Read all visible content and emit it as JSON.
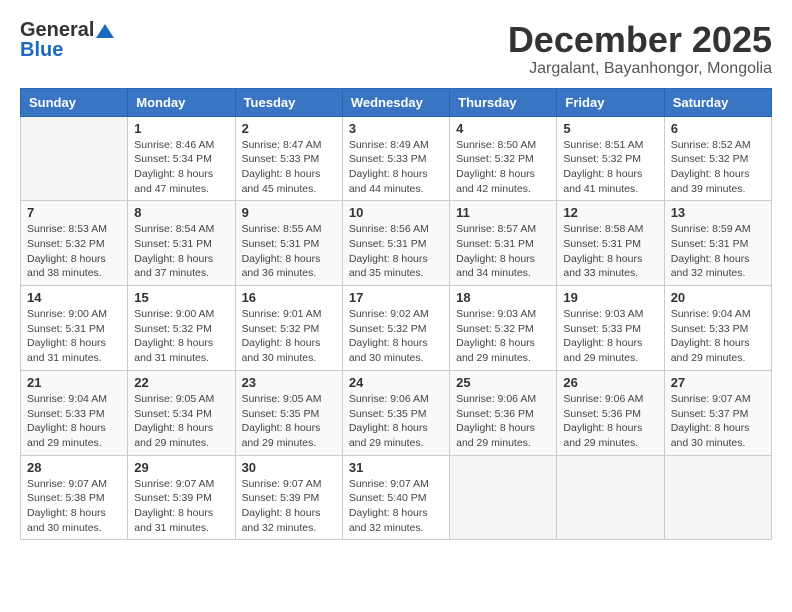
{
  "header": {
    "logo_general": "General",
    "logo_blue": "Blue",
    "month_title": "December 2025",
    "location": "Jargalant, Bayanhongor, Mongolia"
  },
  "days_of_week": [
    "Sunday",
    "Monday",
    "Tuesday",
    "Wednesday",
    "Thursday",
    "Friday",
    "Saturday"
  ],
  "weeks": [
    [
      {
        "day": "",
        "info": ""
      },
      {
        "day": "1",
        "info": "Sunrise: 8:46 AM\nSunset: 5:34 PM\nDaylight: 8 hours\nand 47 minutes."
      },
      {
        "day": "2",
        "info": "Sunrise: 8:47 AM\nSunset: 5:33 PM\nDaylight: 8 hours\nand 45 minutes."
      },
      {
        "day": "3",
        "info": "Sunrise: 8:49 AM\nSunset: 5:33 PM\nDaylight: 8 hours\nand 44 minutes."
      },
      {
        "day": "4",
        "info": "Sunrise: 8:50 AM\nSunset: 5:32 PM\nDaylight: 8 hours\nand 42 minutes."
      },
      {
        "day": "5",
        "info": "Sunrise: 8:51 AM\nSunset: 5:32 PM\nDaylight: 8 hours\nand 41 minutes."
      },
      {
        "day": "6",
        "info": "Sunrise: 8:52 AM\nSunset: 5:32 PM\nDaylight: 8 hours\nand 39 minutes."
      }
    ],
    [
      {
        "day": "7",
        "info": "Sunrise: 8:53 AM\nSunset: 5:32 PM\nDaylight: 8 hours\nand 38 minutes."
      },
      {
        "day": "8",
        "info": "Sunrise: 8:54 AM\nSunset: 5:31 PM\nDaylight: 8 hours\nand 37 minutes."
      },
      {
        "day": "9",
        "info": "Sunrise: 8:55 AM\nSunset: 5:31 PM\nDaylight: 8 hours\nand 36 minutes."
      },
      {
        "day": "10",
        "info": "Sunrise: 8:56 AM\nSunset: 5:31 PM\nDaylight: 8 hours\nand 35 minutes."
      },
      {
        "day": "11",
        "info": "Sunrise: 8:57 AM\nSunset: 5:31 PM\nDaylight: 8 hours\nand 34 minutes."
      },
      {
        "day": "12",
        "info": "Sunrise: 8:58 AM\nSunset: 5:31 PM\nDaylight: 8 hours\nand 33 minutes."
      },
      {
        "day": "13",
        "info": "Sunrise: 8:59 AM\nSunset: 5:31 PM\nDaylight: 8 hours\nand 32 minutes."
      }
    ],
    [
      {
        "day": "14",
        "info": "Sunrise: 9:00 AM\nSunset: 5:31 PM\nDaylight: 8 hours\nand 31 minutes."
      },
      {
        "day": "15",
        "info": "Sunrise: 9:00 AM\nSunset: 5:32 PM\nDaylight: 8 hours\nand 31 minutes."
      },
      {
        "day": "16",
        "info": "Sunrise: 9:01 AM\nSunset: 5:32 PM\nDaylight: 8 hours\nand 30 minutes."
      },
      {
        "day": "17",
        "info": "Sunrise: 9:02 AM\nSunset: 5:32 PM\nDaylight: 8 hours\nand 30 minutes."
      },
      {
        "day": "18",
        "info": "Sunrise: 9:03 AM\nSunset: 5:32 PM\nDaylight: 8 hours\nand 29 minutes."
      },
      {
        "day": "19",
        "info": "Sunrise: 9:03 AM\nSunset: 5:33 PM\nDaylight: 8 hours\nand 29 minutes."
      },
      {
        "day": "20",
        "info": "Sunrise: 9:04 AM\nSunset: 5:33 PM\nDaylight: 8 hours\nand 29 minutes."
      }
    ],
    [
      {
        "day": "21",
        "info": "Sunrise: 9:04 AM\nSunset: 5:33 PM\nDaylight: 8 hours\nand 29 minutes."
      },
      {
        "day": "22",
        "info": "Sunrise: 9:05 AM\nSunset: 5:34 PM\nDaylight: 8 hours\nand 29 minutes."
      },
      {
        "day": "23",
        "info": "Sunrise: 9:05 AM\nSunset: 5:35 PM\nDaylight: 8 hours\nand 29 minutes."
      },
      {
        "day": "24",
        "info": "Sunrise: 9:06 AM\nSunset: 5:35 PM\nDaylight: 8 hours\nand 29 minutes."
      },
      {
        "day": "25",
        "info": "Sunrise: 9:06 AM\nSunset: 5:36 PM\nDaylight: 8 hours\nand 29 minutes."
      },
      {
        "day": "26",
        "info": "Sunrise: 9:06 AM\nSunset: 5:36 PM\nDaylight: 8 hours\nand 29 minutes."
      },
      {
        "day": "27",
        "info": "Sunrise: 9:07 AM\nSunset: 5:37 PM\nDaylight: 8 hours\nand 30 minutes."
      }
    ],
    [
      {
        "day": "28",
        "info": "Sunrise: 9:07 AM\nSunset: 5:38 PM\nDaylight: 8 hours\nand 30 minutes."
      },
      {
        "day": "29",
        "info": "Sunrise: 9:07 AM\nSunset: 5:39 PM\nDaylight: 8 hours\nand 31 minutes."
      },
      {
        "day": "30",
        "info": "Sunrise: 9:07 AM\nSunset: 5:39 PM\nDaylight: 8 hours\nand 32 minutes."
      },
      {
        "day": "31",
        "info": "Sunrise: 9:07 AM\nSunset: 5:40 PM\nDaylight: 8 hours\nand 32 minutes."
      },
      {
        "day": "",
        "info": ""
      },
      {
        "day": "",
        "info": ""
      },
      {
        "day": "",
        "info": ""
      }
    ]
  ]
}
